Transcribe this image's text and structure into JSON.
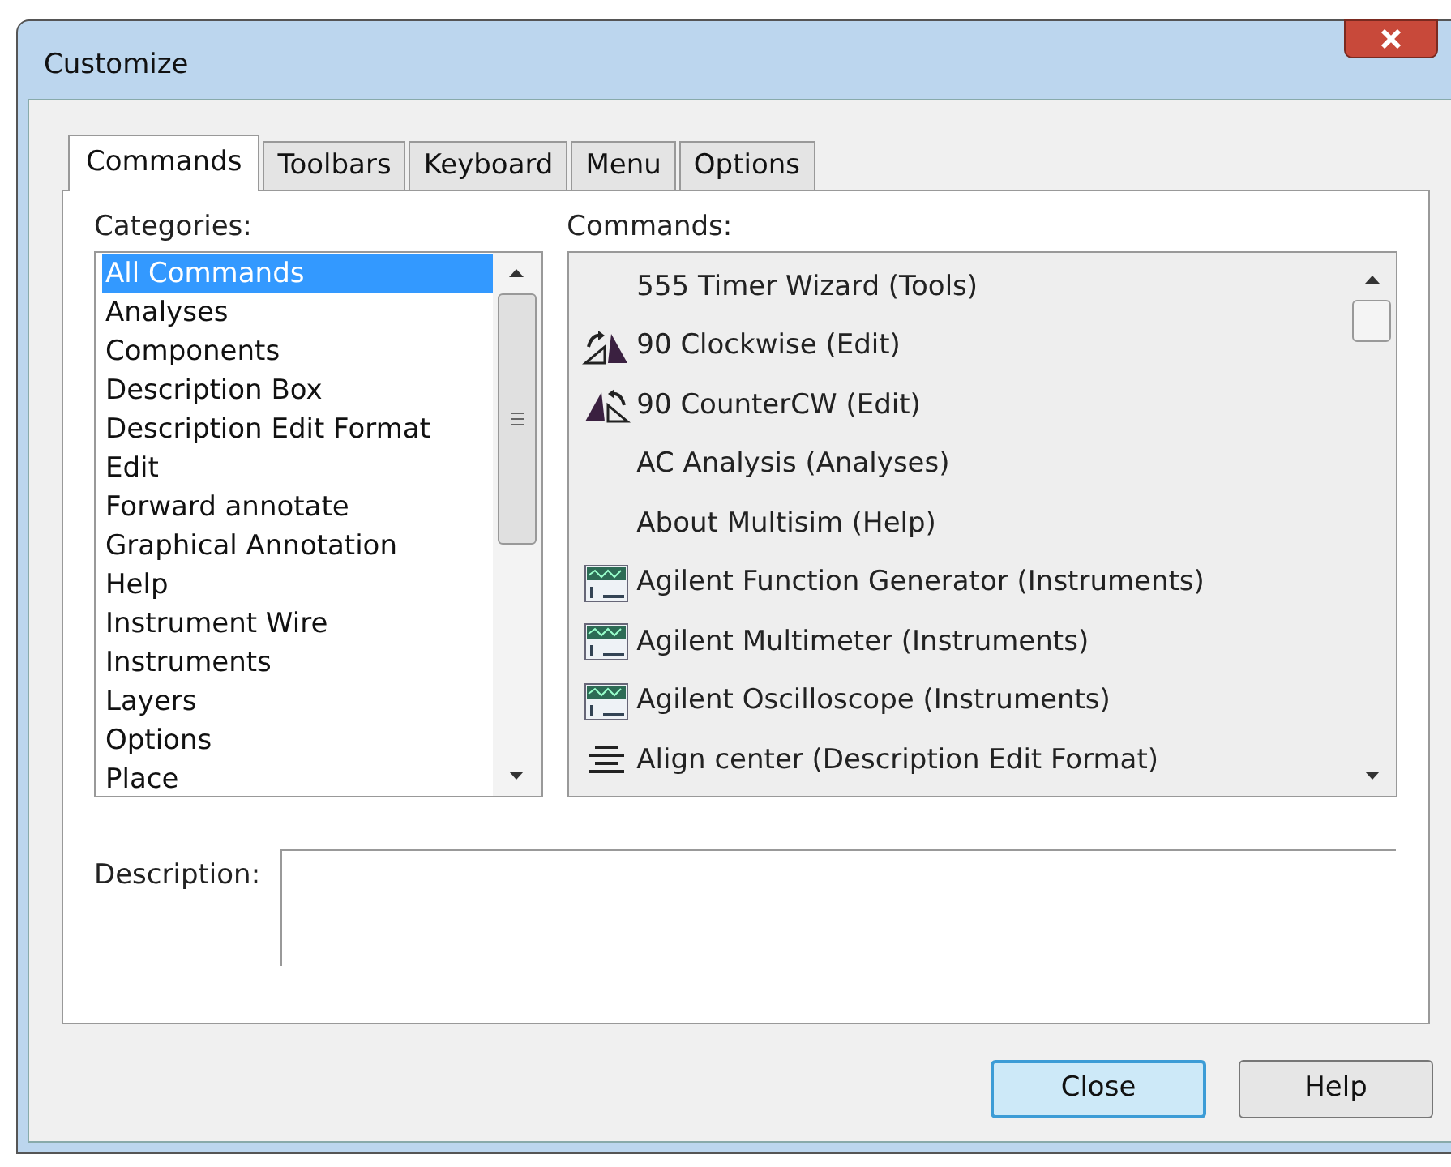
{
  "window": {
    "title": "Customize"
  },
  "tabs": [
    {
      "label": "Commands",
      "selected": true
    },
    {
      "label": "Toolbars",
      "selected": false
    },
    {
      "label": "Keyboard",
      "selected": false
    },
    {
      "label": "Menu",
      "selected": false
    },
    {
      "label": "Options",
      "selected": false
    }
  ],
  "categories": {
    "label": "Categories:",
    "items": [
      {
        "label": "All Commands",
        "selected": true
      },
      {
        "label": "Analyses",
        "selected": false
      },
      {
        "label": "Components",
        "selected": false
      },
      {
        "label": "Description Box",
        "selected": false
      },
      {
        "label": "Description Edit Format",
        "selected": false
      },
      {
        "label": "Edit",
        "selected": false
      },
      {
        "label": "Forward annotate",
        "selected": false
      },
      {
        "label": "Graphical Annotation",
        "selected": false
      },
      {
        "label": "Help",
        "selected": false
      },
      {
        "label": "Instrument Wire",
        "selected": false
      },
      {
        "label": "Instruments",
        "selected": false
      },
      {
        "label": "Layers",
        "selected": false
      },
      {
        "label": "Options",
        "selected": false
      },
      {
        "label": "Place",
        "selected": false
      }
    ]
  },
  "commands": {
    "label": "Commands:",
    "items": [
      {
        "label": "555 Timer Wizard (Tools)",
        "kind": "plain"
      },
      {
        "label": "90 Clockwise (Edit)",
        "kind": "rotate-cw"
      },
      {
        "label": "90 CounterCW (Edit)",
        "kind": "rotate-ccw"
      },
      {
        "label": "AC Analysis (Analyses)",
        "kind": "plain"
      },
      {
        "label": "About Multisim (Help)",
        "kind": "plain"
      },
      {
        "label": "Agilent Function Generator (Instruments)",
        "kind": "instrument"
      },
      {
        "label": "Agilent Multimeter (Instruments)",
        "kind": "instrument"
      },
      {
        "label": "Agilent Oscilloscope (Instruments)",
        "kind": "instrument"
      },
      {
        "label": "Align center (Description Edit Format)",
        "kind": "align"
      }
    ]
  },
  "description": {
    "label": "Description:"
  },
  "buttons": [
    {
      "label": "Close",
      "default": true
    },
    {
      "label": "Help",
      "default": false
    }
  ]
}
